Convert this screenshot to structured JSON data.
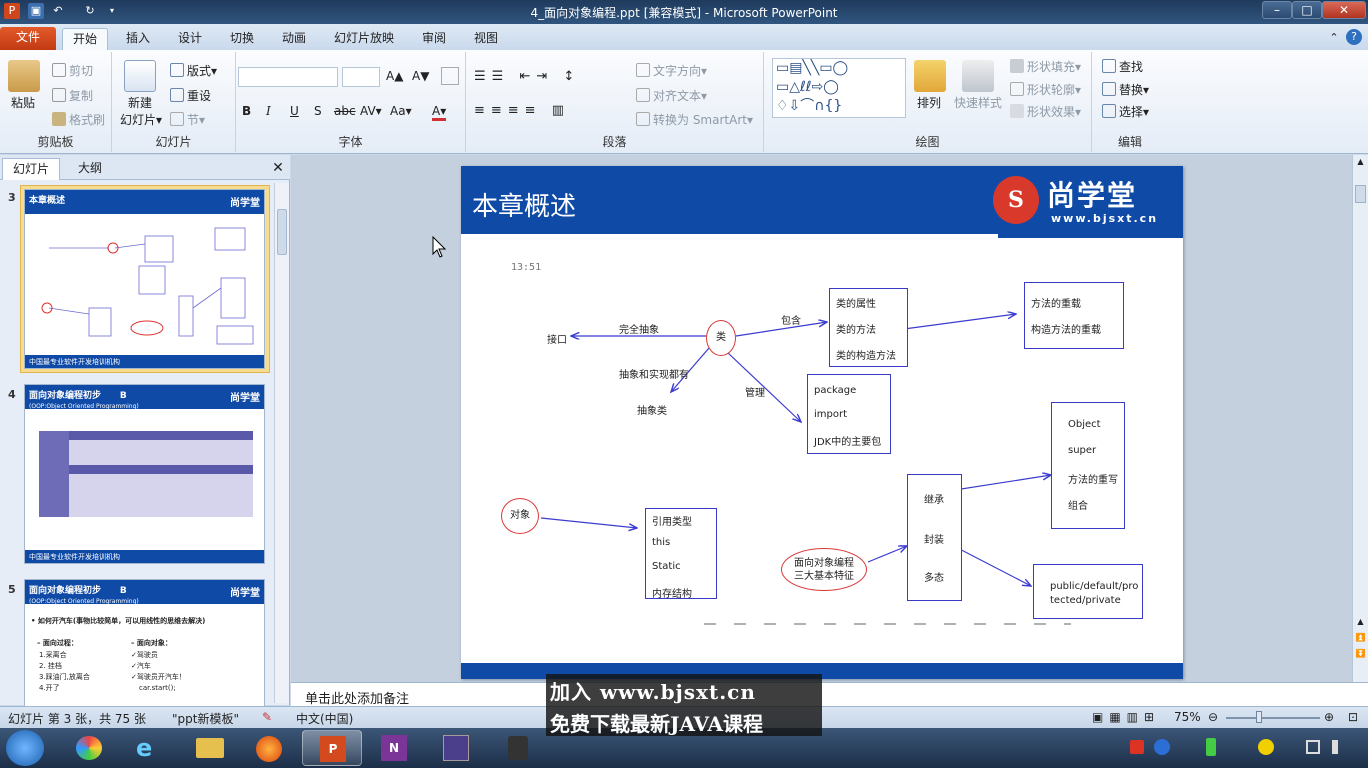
{
  "window": {
    "title": "4_面向对象编程.ppt [兼容模式] - Microsoft PowerPoint",
    "minimize": "–",
    "maximize": "□",
    "close": "✕"
  },
  "tabs": [
    "文件",
    "开始",
    "插入",
    "设计",
    "切换",
    "动画",
    "幻灯片放映",
    "审阅",
    "视图"
  ],
  "ribbon": {
    "clipboard": {
      "label": "剪贴板",
      "paste": "粘贴",
      "cut": "剪切",
      "copy": "复制",
      "format_painter": "格式刷"
    },
    "slides": {
      "label": "幻灯片",
      "new_slide_1": "新建",
      "new_slide_2": "幻灯片▾",
      "layout": "版式▾",
      "reset": "重设",
      "section": "节▾"
    },
    "font": {
      "label": "字体",
      "grow": "A▲",
      "shrink": "A▼",
      "bold": "B",
      "italic": "I",
      "underline": "U",
      "shadow": "S",
      "strike": "abc",
      "spacing": "AV▾",
      "case": "Aa▾",
      "color": "A▾"
    },
    "paragraph": {
      "label": "段落",
      "text_direction": "文字方向▾",
      "align_text": "对齐文本▾",
      "smartart": "转换为 SmartArt▾"
    },
    "drawing": {
      "label": "绘图",
      "arrange": "排列",
      "quick_styles": "快速样式",
      "shape_fill": "形状填充▾",
      "shape_outline": "形状轮廓▾",
      "shape_effects": "形状效果▾"
    },
    "editing": {
      "label": "编辑",
      "find": "查找",
      "replace": "替换▾",
      "select": "选择▾"
    }
  },
  "left_pane": {
    "tab_slides": "幻灯片",
    "tab_outline": "大纲",
    "close": "✕",
    "thumbs": [
      {
        "num": "3",
        "title": "本章概述",
        "footer": "中国最专业软件开发培训机构",
        "logo": "尚学堂"
      },
      {
        "num": "4",
        "title": "面向对象编程初步",
        "subtitle": "(OOP:Object  Oriented Programming)",
        "marker": "B",
        "footer": "中国最专业软件开发培训机构",
        "logo": "尚学堂"
      },
      {
        "num": "5",
        "title": "面向对象编程初步",
        "subtitle": "(OOP:Object  Oriented Programming)",
        "marker": "B",
        "logo": "尚学堂",
        "line1": "• 如何开汽车(事物比较简单，可以用线性的思维去解决)",
        "left_head": "– 面向过程：",
        "left_items": [
          "1.采离合",
          "2. 挂档",
          "3.踩油门,放离合",
          "4.开了"
        ],
        "right_head": "– 面向对象：",
        "right_items": [
          "✓驾驶员",
          "✓汽车",
          "✓驾驶员开汽车！",
          "car.start();"
        ]
      }
    ]
  },
  "slide": {
    "title": "本章概述",
    "logo_text": "尚学堂",
    "logo_url": "www.bjsxt.cn",
    "time": "13:51",
    "interface": "接口",
    "full_abstract": "完全抽象",
    "class_node": "类",
    "contains": "包含",
    "attrs": [
      "类的属性",
      "类的方法",
      "类的构造方法"
    ],
    "overload": [
      "方法的重载",
      "构造方法的重载"
    ],
    "abstract_both": "抽象和实现都有",
    "abstract_class": "抽象类",
    "manage": "管理",
    "packages": [
      "package",
      "import",
      "JDK中的主要包"
    ],
    "object_node": "对象",
    "refs": [
      "引用类型",
      "this",
      "Static",
      "内存结构"
    ],
    "oop_1": "面向对象编程",
    "oop_2": "三大基本特征",
    "features": [
      "继承",
      "封装",
      "多态"
    ],
    "inherit_items": [
      "Object",
      "super",
      "方法的重写",
      "组合"
    ],
    "access_1": "public/default/pro",
    "access_2": "tected/private"
  },
  "notes": {
    "placeholder": "单击此处添加备注"
  },
  "status": {
    "slide_info": "幻灯片 第 3 张，共 75 张",
    "theme": "\"ppt新模板\"",
    "language": "中文(中国)",
    "zoom": "75%"
  },
  "watermark": {
    "line1": "加入 www.bjsxt.cn",
    "line2": "免费下载最新JAVA课程"
  },
  "taskbar": {
    "clock_hidden": ""
  }
}
